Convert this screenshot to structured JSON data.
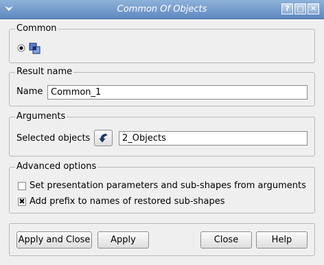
{
  "window": {
    "title": "Common Of Objects"
  },
  "groups": {
    "common": {
      "title": "Common"
    },
    "result_name": {
      "title": "Result name",
      "name_label": "Name",
      "name_value": "Common_1"
    },
    "arguments": {
      "title": "Arguments",
      "selected_label": "Selected objects",
      "selected_value": "2_Objects"
    },
    "advanced": {
      "title": "Advanced options",
      "opt1_label": "Set presentation parameters and sub-shapes from arguments",
      "opt1_checked": false,
      "opt2_label": "Add prefix to names of restored sub-shapes",
      "opt2_checked": true
    }
  },
  "buttons": {
    "apply_close": "Apply and Close",
    "apply": "Apply",
    "close": "Close",
    "help": "Help"
  },
  "titlebar_buttons": {
    "help": "?",
    "maximize": "□",
    "close": "✕"
  },
  "checkmark": "✖"
}
